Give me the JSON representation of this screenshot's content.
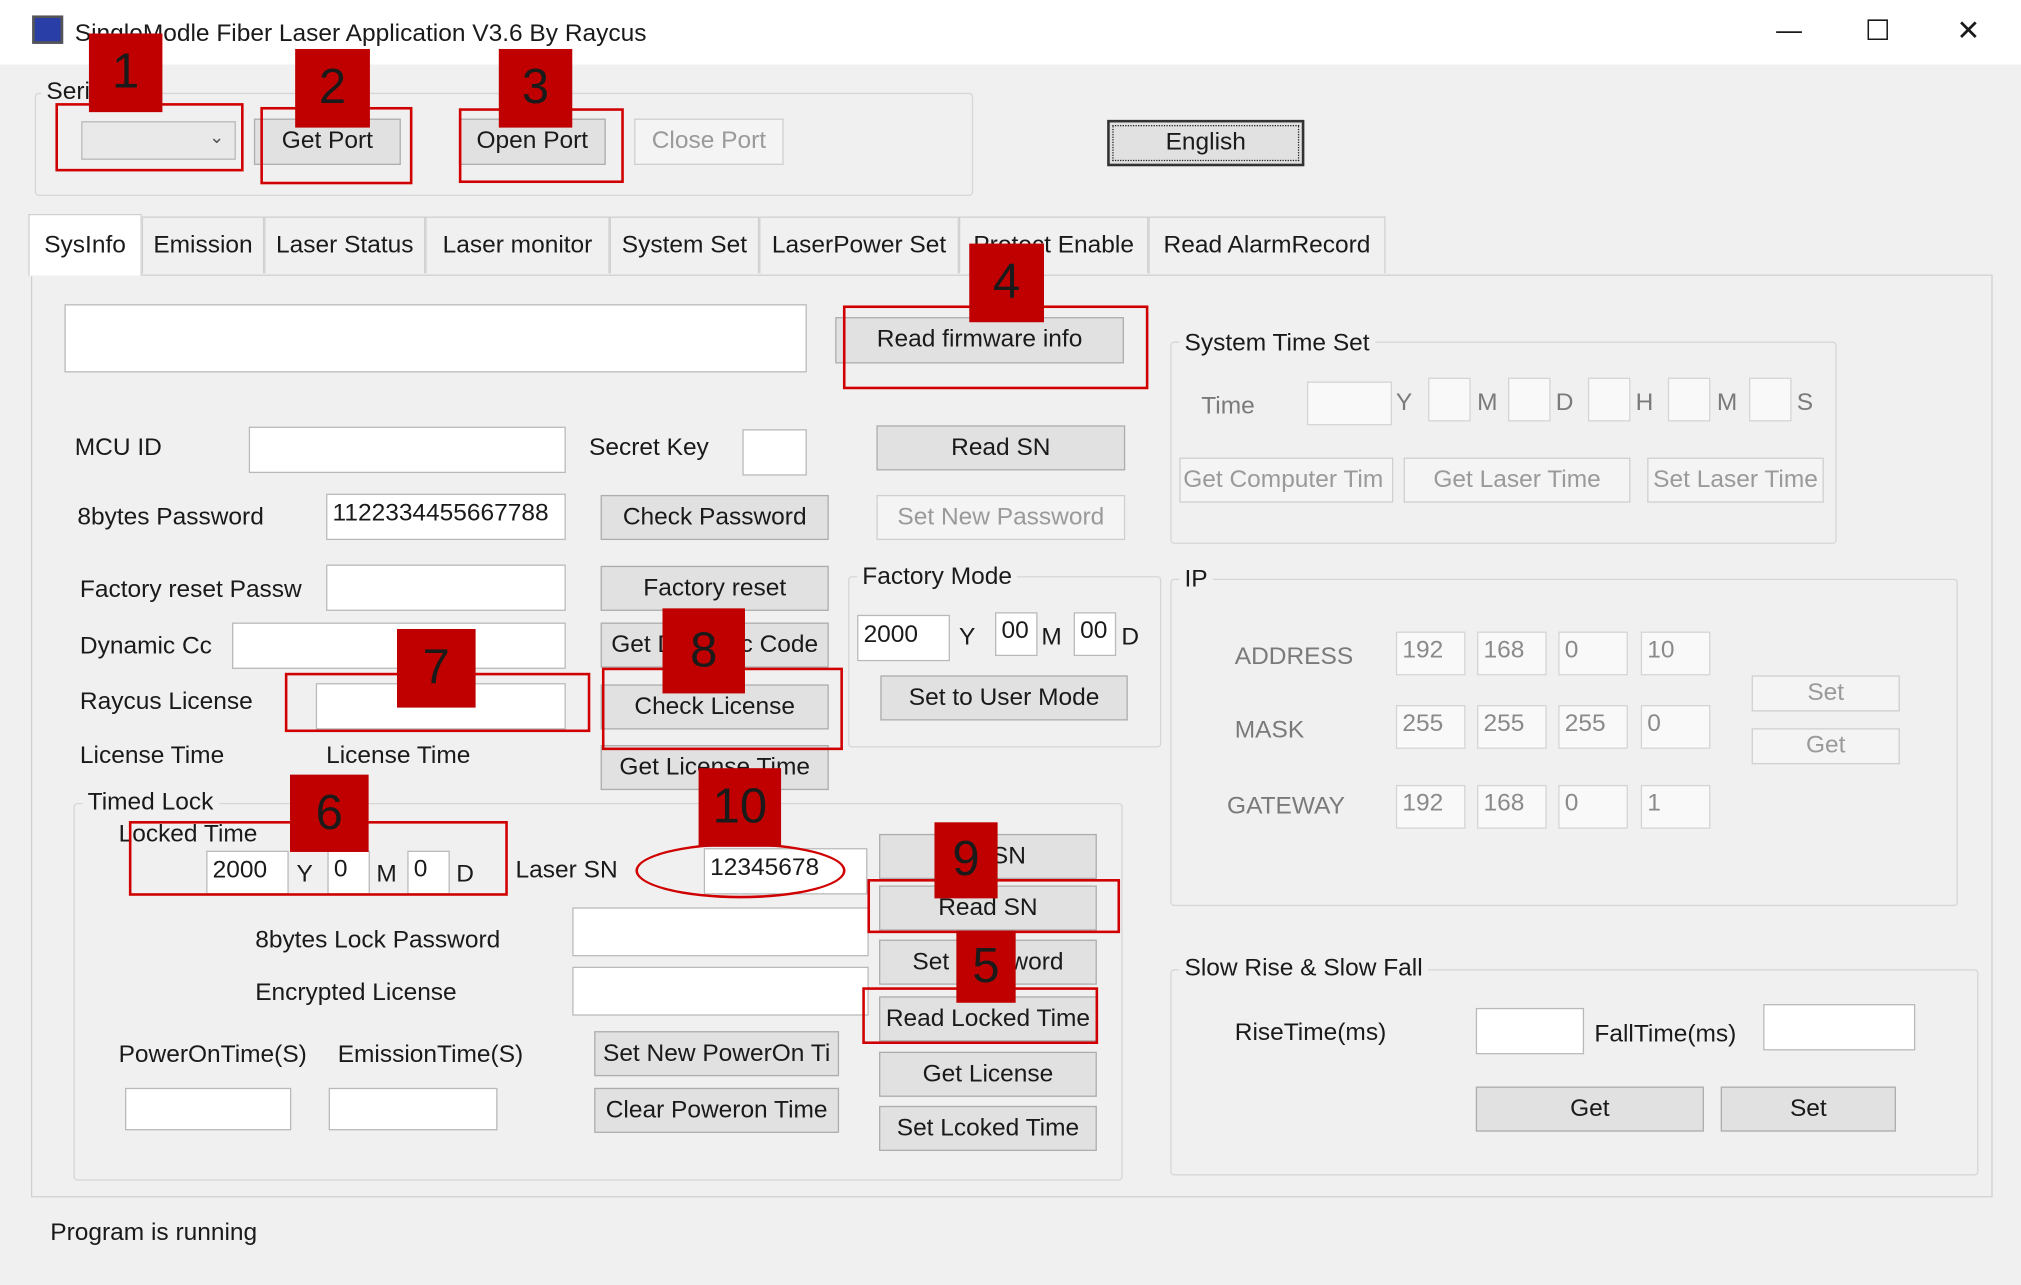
{
  "window": {
    "title": "SingleModle Fiber Laser Application V3.6  By Raycus",
    "minimize": "—",
    "maximize": "☐",
    "close": "✕"
  },
  "serial": {
    "group_title": "Seri",
    "get_port": "Get Port",
    "open_port": "Open Port",
    "close_port": "Close Port",
    "language": "English"
  },
  "tabs": [
    "SysInfo",
    "Emission",
    "Laser Status",
    "Laser monitor",
    "System Set",
    "LaserPower Set",
    "Protect Enable",
    "Read AlarmRecord"
  ],
  "sysinfo": {
    "read_firmware": "Read firmware info",
    "mcu_id": "MCU ID",
    "secret_key": "Secret Key",
    "read_sn": "Read SN",
    "password_label": "8bytes Password",
    "password_value": "1122334455667788",
    "check_password": "Check Password",
    "set_new_password": "Set New Password",
    "factory_reset_label": "Factory reset Passw",
    "factory_reset": "Factory reset",
    "dynamic_label": "Dynamic Cc",
    "get_dynamic_code": "Get Dynamic Code",
    "license_label": "Raycus License",
    "check_license": "Check License",
    "license_time_label": "License Time",
    "license_time_value": "License Time",
    "get_license_time": "Get License Time"
  },
  "factory_mode": {
    "title": "Factory Mode",
    "year": "2000",
    "y": "Y",
    "month": "00",
    "m": "M",
    "day": "00",
    "d": "D",
    "set_user_mode": "Set to User Mode"
  },
  "system_time": {
    "title": "System Time Set",
    "time_label": "Time",
    "units": [
      "Y",
      "M",
      "D",
      "H",
      "M",
      "S"
    ],
    "get_computer_time": "Get Computer Tim",
    "get_laser_time": "Get Laser Time",
    "set_laser_time": "Set Laser Time"
  },
  "ip": {
    "title": "IP",
    "address_label": "ADDRESS",
    "address": [
      "192",
      "168",
      "0",
      "10"
    ],
    "mask_label": "MASK",
    "mask": [
      "255",
      "255",
      "255",
      "0"
    ],
    "gateway_label": "GATEWAY",
    "gateway": [
      "192",
      "168",
      "0",
      "1"
    ],
    "set": "Set",
    "get": "Get"
  },
  "slow_rise": {
    "title": "Slow Rise & Slow Fall",
    "rise_label": "RiseTime(ms)",
    "fall_label": "FallTime(ms)",
    "get": "Get",
    "set": "Set"
  },
  "timed_lock": {
    "title": "Timed Lock",
    "locked_time": "Locked Time",
    "year": "2000",
    "y": "Y",
    "month": "0",
    "m": "M",
    "day": "0",
    "d": "D",
    "laser_sn_label": "Laser SN",
    "laser_sn": "12345678",
    "write_sn": "SN",
    "read_sn": "Read SN",
    "set_password": "Set Password",
    "read_locked_time": "Read Locked Time",
    "get_license": "Get License",
    "set_locked_time": "Set Lcoked Time",
    "lock_password_label": "8bytes Lock Password",
    "encrypted_license_label": "Encrypted License",
    "poweron_label": "PowerOnTime(S)",
    "emission_label": "EmissionTime(S)",
    "set_new_poweron": "Set New PowerOn Ti",
    "clear_poweron": "Clear Poweron Time"
  },
  "status": "Program is running",
  "annotations": [
    "1",
    "2",
    "3",
    "4",
    "5",
    "6",
    "7",
    "8",
    "9",
    "10"
  ],
  "colors": {
    "annotation": "#c00000",
    "window_bg": "#f0f0f0"
  }
}
